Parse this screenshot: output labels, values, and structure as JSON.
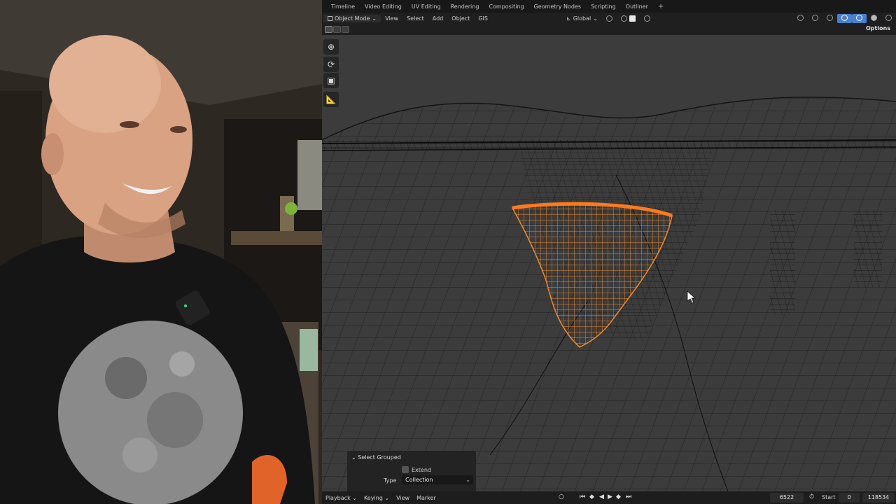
{
  "workspace_tabs": [
    "Timeline",
    "Video Editing",
    "UV Editing",
    "Rendering",
    "Compositing",
    "Geometry Nodes",
    "Scripting",
    "Outliner"
  ],
  "add_workspace": "+",
  "header": {
    "mode": "Object Mode",
    "menus": [
      "View",
      "Select",
      "Add",
      "Object",
      "GIS"
    ],
    "orientation": "Global"
  },
  "options_label": "Options",
  "operator_panel": {
    "title": "Select Grouped",
    "extend_label": "Extend",
    "extend_checked": false,
    "type_label": "Type",
    "type_value": "Collection"
  },
  "timeline": {
    "menus": [
      "Playback",
      "Keying",
      "View",
      "Marker"
    ],
    "current_frame": "6522",
    "start_label": "Start",
    "start_value": "0",
    "end_value": "118534"
  },
  "colors": {
    "selection_orange": "#f08a2a",
    "wire": "#0d0d0d",
    "viewport_bg": "#3c3c3c",
    "active_blue": "#4a7fd0"
  }
}
